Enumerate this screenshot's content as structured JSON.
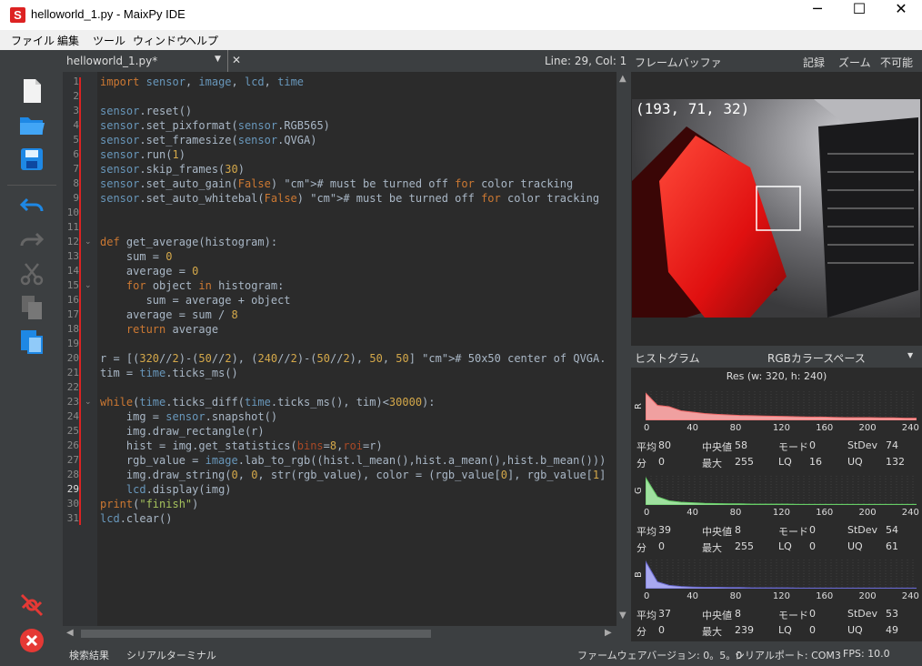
{
  "window": {
    "title": "helloworld_1.py - MaixPy IDE",
    "app_icon": "S",
    "minimize": "─",
    "maximize": "☐",
    "close": "✕"
  },
  "menu": [
    "ファイル",
    "編集",
    "ツール",
    "ウィンドウ",
    "ヘルプ"
  ],
  "editor": {
    "tab": "helloworld_1.py*",
    "tab_close": "✕",
    "position": "Line: 29, Col: 1",
    "current_line": 29
  },
  "code_lines": [
    "import sensor, image, lcd, time",
    "",
    "sensor.reset()",
    "sensor.set_pixformat(sensor.RGB565)",
    "sensor.set_framesize(sensor.QVGA)",
    "sensor.run(1)",
    "sensor.skip_frames(30)",
    "sensor.set_auto_gain(False) # must be turned off for color tracking",
    "sensor.set_auto_whitebal(False) # must be turned off for color tracking",
    "",
    "",
    "def get_average(histogram):",
    "    sum = 0",
    "    average = 0",
    "    for object in histogram:",
    "       sum = average + object",
    "    average = sum / 8",
    "    return average",
    "",
    "r = [(320//2)-(50//2), (240//2)-(50//2), 50, 50] # 50x50 center of QVGA.",
    "tim = time.ticks_ms()",
    "",
    "while(time.ticks_diff(time.ticks_ms(), tim)<30000):",
    "    img = sensor.snapshot()",
    "    img.draw_rectangle(r)",
    "    hist = img.get_statistics(bins=8,roi=r)",
    "    rgb_value = image.lab_to_rgb((hist.l_mean(),hist.a_mean(),hist.b_mean()))",
    "    img.draw_string(0, 0, str(rgb_value), color = (rgb_value[0], rgb_value[1]",
    "    lcd.display(img)",
    "print(\"finish\")",
    "lcd.clear()"
  ],
  "framebuffer": {
    "title": "フレームバッファ",
    "record": "記録",
    "zoom": "ズーム",
    "disable": "不可能",
    "overlay_text": "(193, 71, 32)"
  },
  "histogram": {
    "title": "ヒストグラム",
    "colorspace": "RGBカラースペース",
    "resolution": "Res (w: 320, h: 240)",
    "x_ticks": [
      "0",
      "40",
      "80",
      "120",
      "160",
      "200",
      "240"
    ],
    "stat_labels": {
      "mean": "平均",
      "median": "中央値",
      "mode": "モード",
      "stdev": "StDev",
      "min": "分",
      "max": "最大",
      "lq": "LQ",
      "uq": "UQ"
    },
    "channels": [
      {
        "name": "R",
        "color": "#e66",
        "fill": "#f0a0a0",
        "mean": "80",
        "median": "58",
        "mode": "0",
        "stdev": "74",
        "min": "0",
        "max": "255",
        "lq": "16",
        "uq": "132"
      },
      {
        "name": "G",
        "color": "#6c6",
        "fill": "#9fe09f",
        "mean": "39",
        "median": "8",
        "mode": "0",
        "stdev": "54",
        "min": "0",
        "max": "255",
        "lq": "0",
        "uq": "61"
      },
      {
        "name": "B",
        "color": "#66c",
        "fill": "#a8a8f0",
        "mean": "37",
        "median": "8",
        "mode": "0",
        "stdev": "53",
        "min": "0",
        "max": "239",
        "lq": "0",
        "uq": "49"
      }
    ]
  },
  "status": {
    "search_results": "検索結果",
    "serial_terminal": "シリアルターミナル",
    "firmware": "ファームウェアバージョン: 0。5。0",
    "serial_port": "シリアルポート: COM3",
    "fps": "FPS:   10.0"
  }
}
